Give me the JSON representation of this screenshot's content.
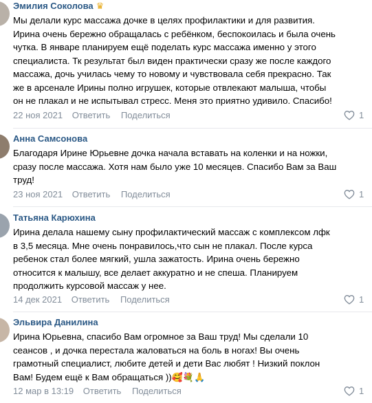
{
  "comments": [
    {
      "author": "Эмилия Соколова",
      "text": "Мы делали курс массажа дочке в целях профилактики и для развития.\nИрина очень бережно обращалась с ребёнком, беспокоилась и была очень\nчутка. В январе планируем ещё поделать курс массажа именно у этого\nспециалиста. Тк результат был виден практически сразу же после каждого\nмассажа, дочь училась чему то новому и чувствовала себя прекрасно. Так\nже в арсенале Ирины полно игрушек, которые отвлекают малыша, чтобы\nон не плакал и не испытывал стресс. Меня это приятно удивило. Спасибо!",
      "date": "22 ноя 2021",
      "reply": "Ответить",
      "share": "Поделиться",
      "likes": "1"
    },
    {
      "author": "Анна Самсонова",
      "text": "Благодаря Ирине Юрьевне дочка начала вставать на коленки и на ножки,\nсразу после массажа. Хотя нам было уже 10 месяцев. Спасибо Вам за Ваш\nтруд!",
      "date": "23 ноя 2021",
      "reply": "Ответить",
      "share": "Поделиться",
      "likes": "1"
    },
    {
      "author": "Татьяна Карюхина",
      "text": "Ирина делала нашему сыну профилактический массаж с комплексом лфк\nв 3,5 месяца. Мне очень понравилось,что сын не плакал. После курса\nребенок стал более мягкий, ушла зажатость. Ирина очень бережно\nотносится к малышу, все делает аккуратно и не спеша. Планируем\nпродолжить курсовой массаж у нее.",
      "date": "14 дек 2021",
      "reply": "Ответить",
      "share": "Поделиться",
      "likes": "1"
    },
    {
      "author": "Эльвира Данилина",
      "text": "Ирина Юрьевна, спасибо Вам огромное за Ваш труд! Мы сделали 10\nсеансов , и дочка перестала жаловаться на боль в ногах! Вы очень\nграмотный специалист, любите детей и дети Вас любят ! Низкий поклон\nВам! Будем ещё к Вам обращаться ))",
      "emoji": "🥰💐🙏",
      "date": "12 мар в 13:19",
      "reply": "Ответить",
      "share": "Поделиться",
      "likes": "1"
    }
  ],
  "icons": {
    "crown": "crown-icon",
    "like": "heart-icon"
  },
  "colors": {
    "author": "#2a5885",
    "meta": "#818c99",
    "divider": "#e7e8ec",
    "crown": "#e6a817"
  }
}
